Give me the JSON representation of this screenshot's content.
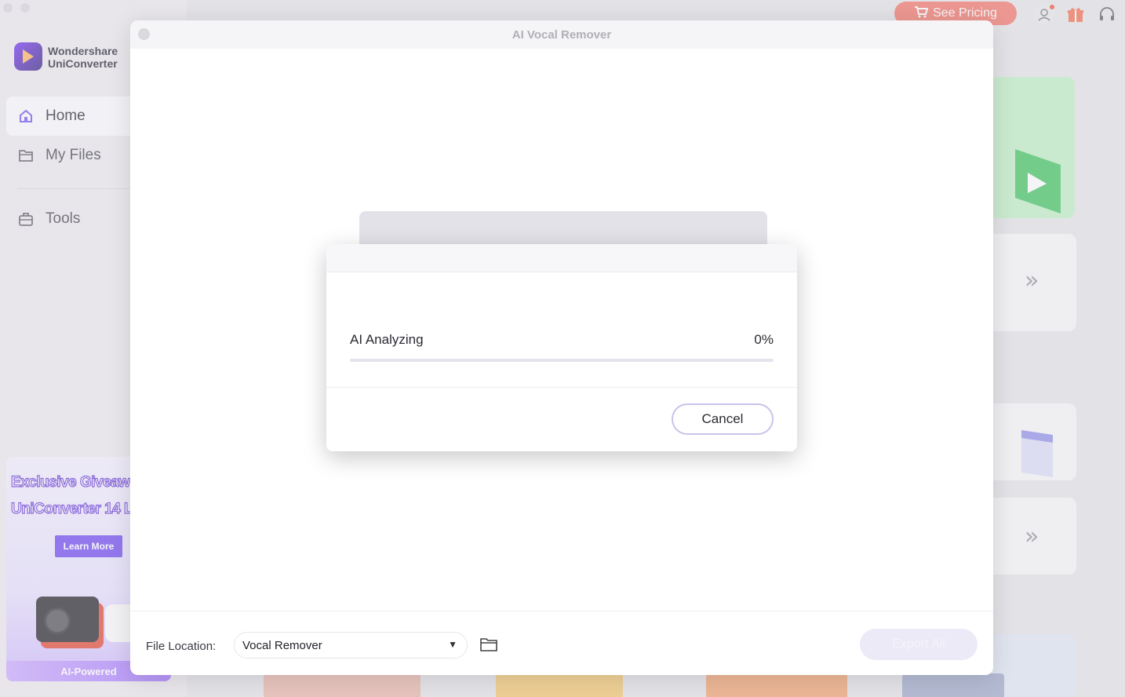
{
  "app": {
    "brand_line1": "Wondershare",
    "brand_line2": "UniConverter",
    "nav": {
      "home": "Home",
      "my_files": "My Files",
      "tools": "Tools"
    },
    "promo": {
      "line1": "Exclusive Giveaw",
      "line2": "UniConverter 14 L",
      "learn_more": "Learn More",
      "badge": "AI-Powered"
    },
    "top_bar": {
      "pricing_label": "See Pricing"
    }
  },
  "modal": {
    "title": "AI Vocal Remover",
    "progress": {
      "label": "AI Analyzing",
      "percent_text": "0%",
      "value": 0
    },
    "cancel_label": "Cancel",
    "footer": {
      "file_location_label": "File Location:",
      "file_location_value": "Vocal Remover",
      "export_all_label": "Export All"
    }
  },
  "colors": {
    "accent": "#7b5cf0",
    "pricing": "#f27065",
    "promo_button": "#6941f1"
  }
}
